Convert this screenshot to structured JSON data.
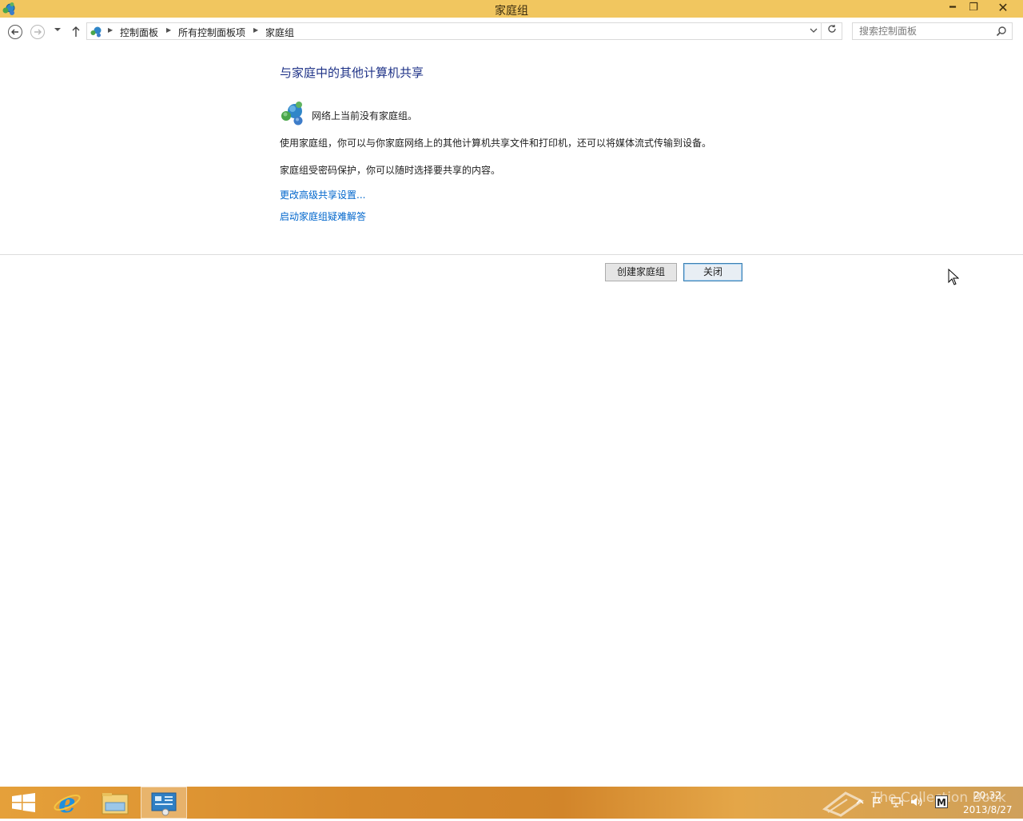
{
  "window": {
    "title": "家庭组",
    "min_glyph": "━",
    "max_glyph": "❐",
    "close_glyph": "✕"
  },
  "address": {
    "crumbs": [
      "控制面板",
      "所有控制面板项",
      "家庭组"
    ],
    "search_placeholder": "搜索控制面板"
  },
  "content": {
    "title": "与家庭中的其他计算机共享",
    "status": "网络上当前没有家庭组。",
    "para1": "使用家庭组，你可以与你家庭网络上的其他计算机共享文件和打印机，还可以将媒体流式传输到设备。",
    "para2": "家庭组受密码保护，你可以随时选择要共享的内容。",
    "link_advanced": "更改高级共享设置...",
    "link_troubleshoot": "启动家庭组疑难解答"
  },
  "buttons": {
    "create": "创建家庭组",
    "close": "关闭"
  },
  "taskbar": {
    "watermark": "The Collection Book",
    "time": "20:32",
    "date": "2013/8/27"
  },
  "colors": {
    "titlebar": "#f1c65f",
    "link": "#0066cc",
    "heading": "#1e3287"
  }
}
